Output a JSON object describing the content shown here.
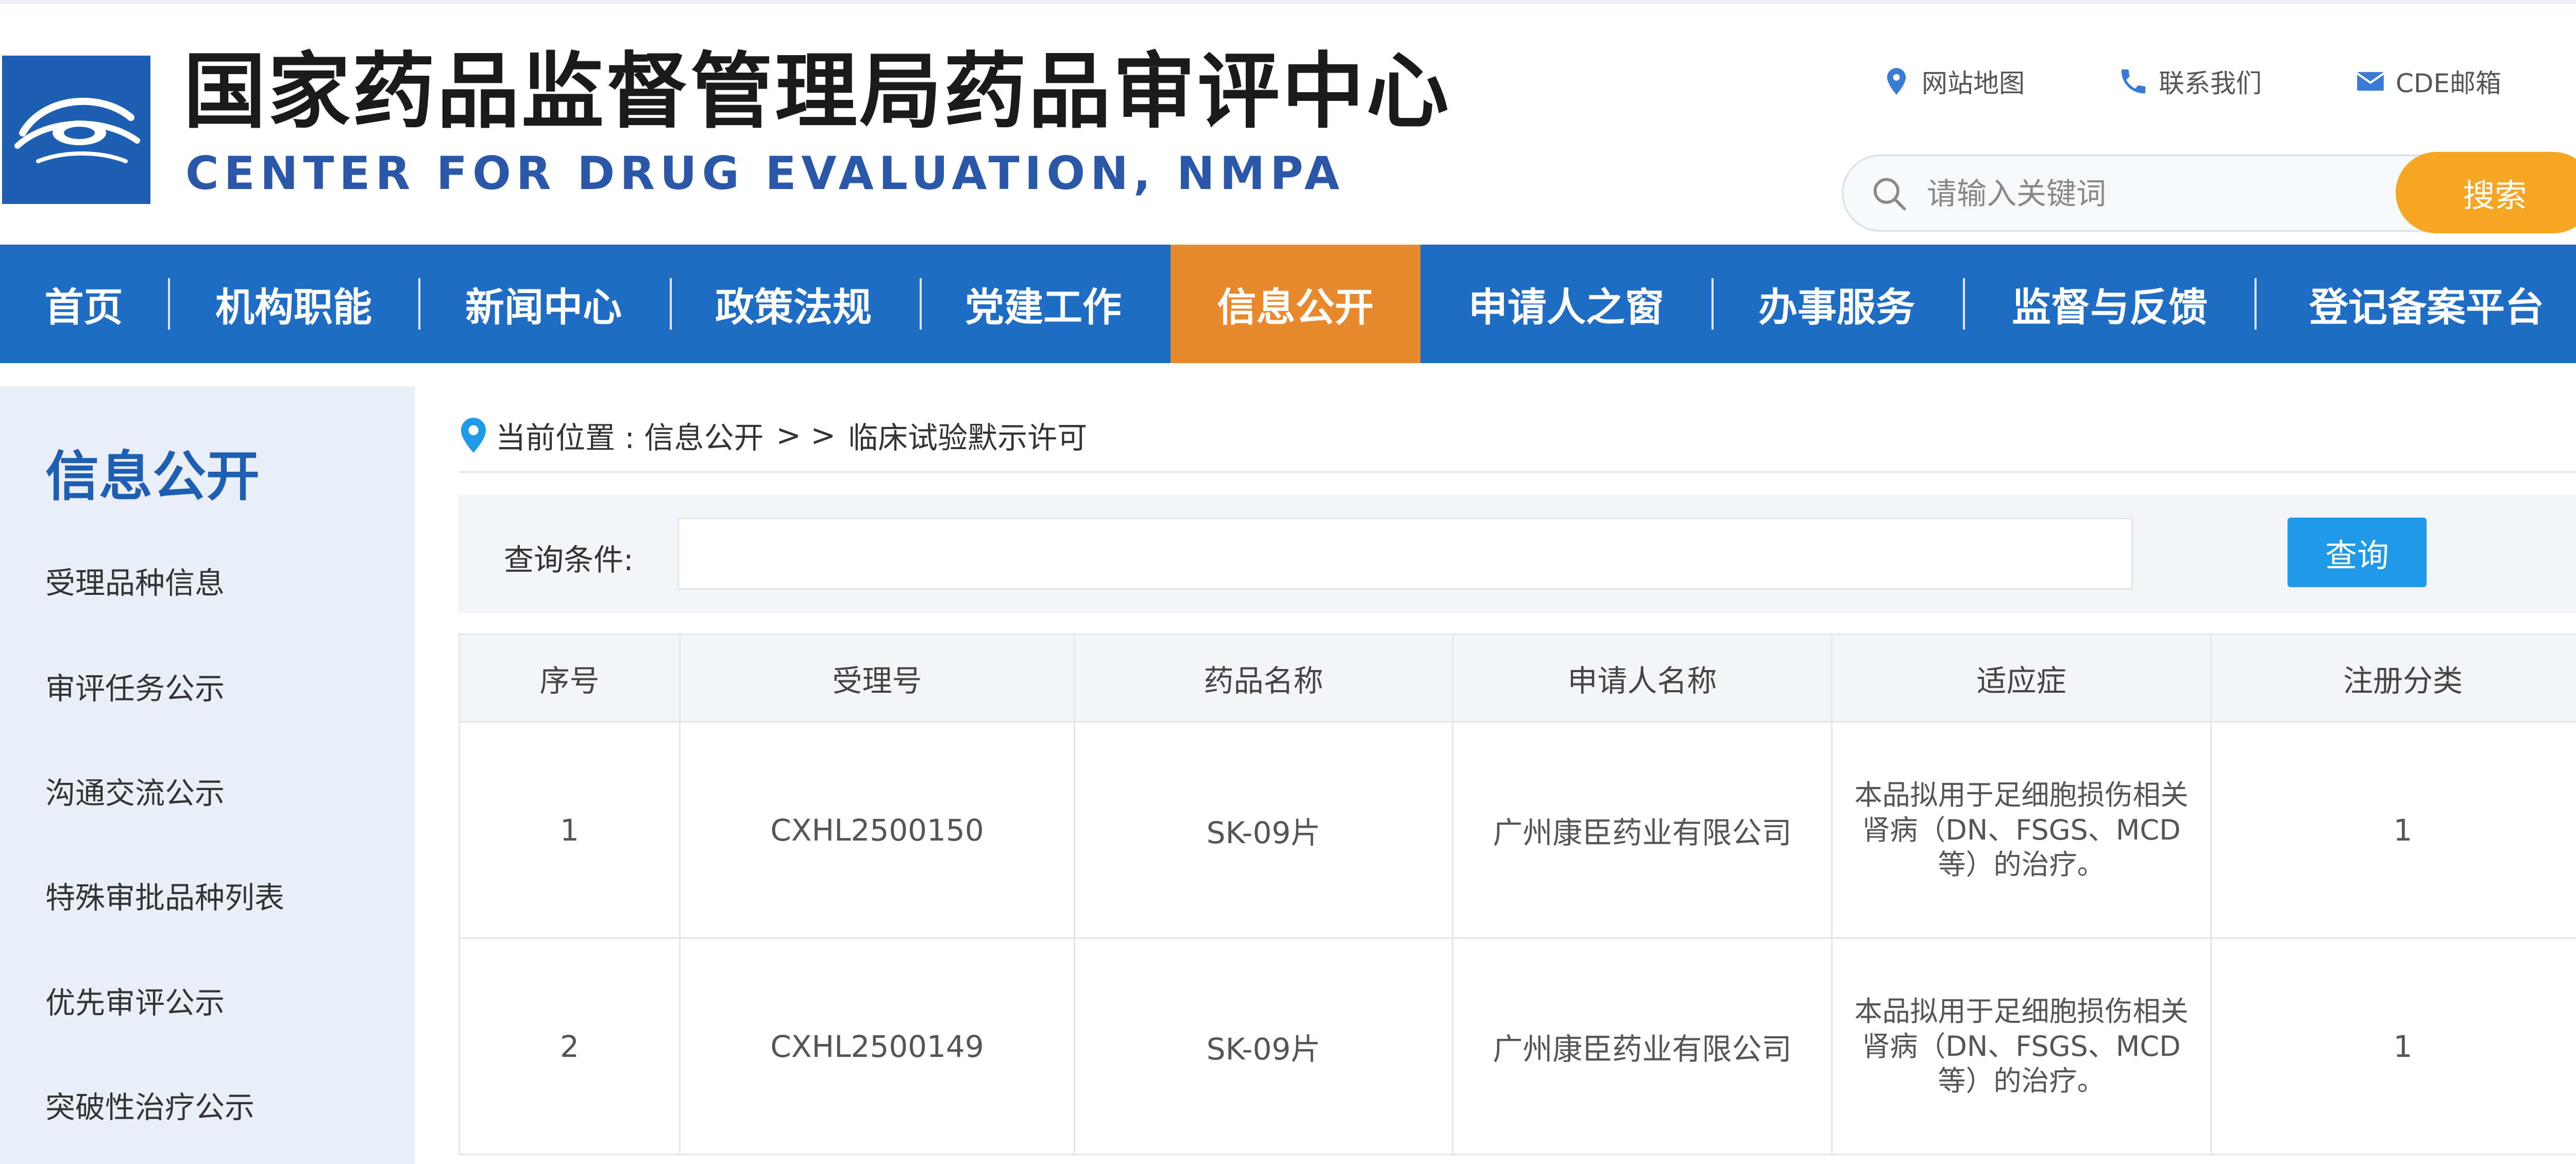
{
  "header": {
    "title_cn": "国家药品监督管理局药品审评中心",
    "title_en": "CENTER FOR DRUG EVALUATION, NMPA",
    "top_links": [
      {
        "label": "网站地图",
        "icon": "map-pin-icon"
      },
      {
        "label": "联系我们",
        "icon": "phone-icon"
      },
      {
        "label": "CDE邮箱",
        "icon": "mail-icon"
      }
    ],
    "search": {
      "placeholder": "请输入关键词",
      "button_label": "搜索"
    }
  },
  "nav": {
    "items": [
      {
        "label": "首页"
      },
      {
        "label": "机构职能"
      },
      {
        "label": "新闻中心"
      },
      {
        "label": "政策法规"
      },
      {
        "label": "党建工作"
      },
      {
        "label": "信息公开",
        "active": true
      },
      {
        "label": "申请人之窗"
      },
      {
        "label": "办事服务"
      },
      {
        "label": "监督与反馈"
      },
      {
        "label": "登记备案平台"
      }
    ]
  },
  "sidebar": {
    "title": "信息公开",
    "items": [
      {
        "label": "受理品种信息"
      },
      {
        "label": "审评任务公示"
      },
      {
        "label": "沟通交流公示"
      },
      {
        "label": "特殊审批品种列表"
      },
      {
        "label": "优先审评公示"
      },
      {
        "label": "突破性治疗公示"
      }
    ]
  },
  "breadcrumb": {
    "prefix": "当前位置 : 信息公开",
    "separator": "> >",
    "current": "临床试验默示许可"
  },
  "query": {
    "label": "查询条件:",
    "value": "",
    "button_label": "查询"
  },
  "table": {
    "columns": [
      "序号",
      "受理号",
      "药品名称",
      "申请人名称",
      "适应症",
      "注册分类"
    ],
    "rows": [
      [
        "1",
        "CXHL2500150",
        "SK-09片",
        "广州康臣药业有限公司",
        "本品拟用于足细胞损伤相关肾病（DN、FSGS、MCD等）的治疗。",
        "1"
      ],
      [
        "2",
        "CXHL2500149",
        "SK-09片",
        "广州康臣药业有限公司",
        "本品拟用于足细胞损伤相关肾病（DN、FSGS、MCD等）的治疗。",
        "1"
      ]
    ]
  },
  "colors": {
    "nav_bg": "#1f6cc4",
    "nav_active": "#e8892d",
    "search_button": "#f5a623",
    "query_button": "#1e9ae8",
    "title_en": "#2b57a8",
    "sidebar_bg": "#e9eef7"
  }
}
